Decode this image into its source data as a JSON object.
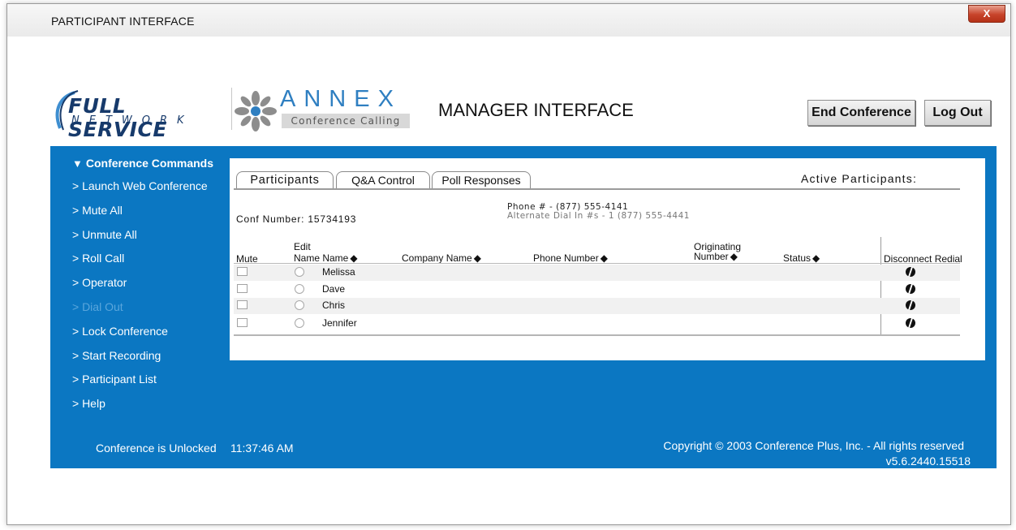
{
  "window": {
    "title": "PARTICIPANT INTERFACE",
    "close_label": "X"
  },
  "header": {
    "fsn_logo": {
      "line1": "FULL SERVICE",
      "line2": "NETWORK"
    },
    "annex_logo": {
      "word": "ANNEX",
      "sub": "Conference Calling"
    },
    "title": "MANAGER INTERFACE",
    "end_conference": "End Conference",
    "log_out": "Log Out"
  },
  "sidebar": {
    "heading": "Conference Commands",
    "items": [
      {
        "label": "> Launch Web Conference",
        "enabled": true
      },
      {
        "label": "> Mute All",
        "enabled": true
      },
      {
        "label": "> Unmute All",
        "enabled": true
      },
      {
        "label": "> Roll Call",
        "enabled": true
      },
      {
        "label": "> Operator",
        "enabled": true
      },
      {
        "label": "> Dial Out",
        "enabled": false
      },
      {
        "label": "> Lock Conference",
        "enabled": true
      },
      {
        "label": "> Start Recording",
        "enabled": true
      },
      {
        "label": "> Participant List",
        "enabled": true
      },
      {
        "label": "> Help",
        "enabled": true
      }
    ]
  },
  "tabs": [
    {
      "label": "Participants",
      "active": true
    },
    {
      "label": "Q&A Control",
      "active": false
    },
    {
      "label": "Poll Responses",
      "active": false
    }
  ],
  "active_participants_label": "Active Participants:",
  "conference": {
    "conf_number": "Conf Number: 15734193",
    "phone": "Phone # - (877) 555-4141",
    "alternate": "Alternate Dial In #s - 1 (877) 555-4441"
  },
  "table": {
    "columns": {
      "mute": "Mute",
      "edit_name": "Edit",
      "name": "Name Name",
      "company": "Company Name",
      "phone": "Phone Number",
      "orig1": "Originating",
      "orig2": "Number",
      "status": "Status",
      "disconnect": "Disconnect Redial"
    },
    "rows": [
      {
        "name": "Melissa"
      },
      {
        "name": "Dave"
      },
      {
        "name": "Chris"
      },
      {
        "name": "Jennifer"
      }
    ]
  },
  "footer": {
    "status": "Conference is Unlocked",
    "time": "11:37:46 AM",
    "copyright": "Copyright © 2003 Conference Plus, Inc. - All rights reserved",
    "version": "v5.6.2440.15518"
  },
  "colors": {
    "panel_blue": "#0b77c2",
    "logo_blue": "#173a6b",
    "annex_blue": "#2f7fc1",
    "close_red": "#c7432a"
  },
  "icons": {
    "sort": "up-down-arrows-icon",
    "disconnect": "disconnect-icon",
    "close": "close-icon"
  }
}
